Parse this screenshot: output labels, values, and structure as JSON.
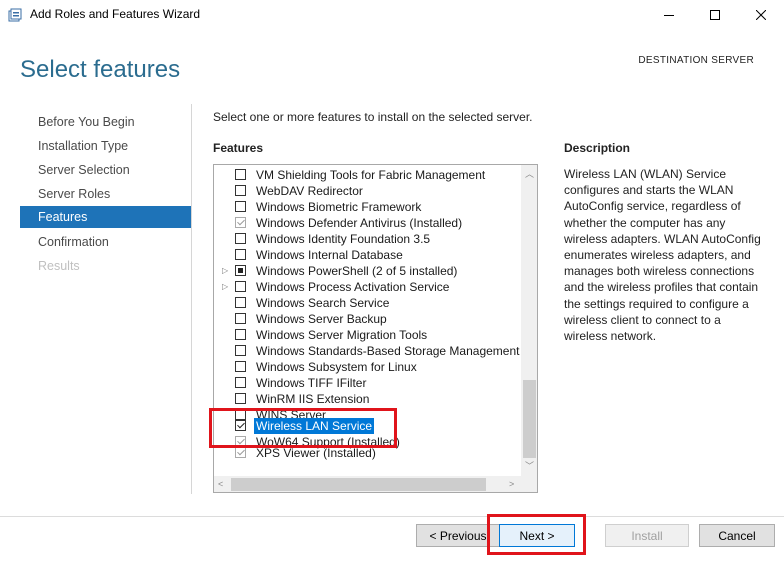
{
  "window": {
    "title": "Add Roles and Features Wizard",
    "icon": "server-manager-icon",
    "controls": [
      "minimize-icon",
      "maximize-icon",
      "close-icon"
    ]
  },
  "page_title": "Select features",
  "destination_label": "DESTINATION SERVER",
  "nav": {
    "items": [
      {
        "label": "Before You Begin",
        "state": "normal"
      },
      {
        "label": "Installation Type",
        "state": "normal"
      },
      {
        "label": "Server Selection",
        "state": "normal"
      },
      {
        "label": "Server Roles",
        "state": "normal"
      },
      {
        "label": "Features",
        "state": "active"
      },
      {
        "label": "Confirmation",
        "state": "normal"
      },
      {
        "label": "Results",
        "state": "disabled"
      }
    ]
  },
  "intro": "Select one or more features to install on the selected server.",
  "features_header": "Features",
  "features": [
    {
      "label": "VM Shielding Tools for Fabric Management",
      "check": "unchecked",
      "expander": false
    },
    {
      "label": "WebDAV Redirector",
      "check": "unchecked",
      "expander": false
    },
    {
      "label": "Windows Biometric Framework",
      "check": "unchecked",
      "expander": false
    },
    {
      "label": "Windows Defender Antivirus (Installed)",
      "check": "installed",
      "expander": false
    },
    {
      "label": "Windows Identity Foundation 3.5",
      "check": "unchecked",
      "expander": false
    },
    {
      "label": "Windows Internal Database",
      "check": "unchecked",
      "expander": false
    },
    {
      "label": "Windows PowerShell (2 of 5 installed)",
      "check": "partial",
      "expander": true
    },
    {
      "label": "Windows Process Activation Service",
      "check": "unchecked",
      "expander": true
    },
    {
      "label": "Windows Search Service",
      "check": "unchecked",
      "expander": false
    },
    {
      "label": "Windows Server Backup",
      "check": "unchecked",
      "expander": false
    },
    {
      "label": "Windows Server Migration Tools",
      "check": "unchecked",
      "expander": false
    },
    {
      "label": "Windows Standards-Based Storage Management",
      "check": "unchecked",
      "expander": false
    },
    {
      "label": "Windows Subsystem for Linux",
      "check": "unchecked",
      "expander": false
    },
    {
      "label": "Windows TIFF IFilter",
      "check": "unchecked",
      "expander": false
    },
    {
      "label": "WinRM IIS Extension",
      "check": "unchecked",
      "expander": false
    },
    {
      "label": "WINS Server",
      "check": "unchecked",
      "expander": false,
      "partially_hidden": true
    },
    {
      "label": "Wireless LAN Service",
      "check": "checked",
      "expander": false,
      "selected": true
    },
    {
      "label": "WoW64 Support (Installed)",
      "check": "installed",
      "expander": false,
      "partially_hidden": true
    },
    {
      "label": "XPS Viewer (Installed)",
      "check": "installed",
      "expander": false
    }
  ],
  "description_header": "Description",
  "description": "Wireless LAN (WLAN) Service configures and starts the WLAN AutoConfig service, regardless of whether the computer has any wireless adapters. WLAN AutoConfig enumerates wireless adapters, and manages both wireless connections and the wireless profiles that contain the settings required to configure a wireless client to connect to a wireless network.",
  "buttons": {
    "previous": "< Previous",
    "next": "Next >",
    "install": "Install",
    "cancel": "Cancel"
  },
  "colors": {
    "accent": "#1e73b8",
    "title": "#2b6c8f",
    "highlight": "#e0141b"
  }
}
